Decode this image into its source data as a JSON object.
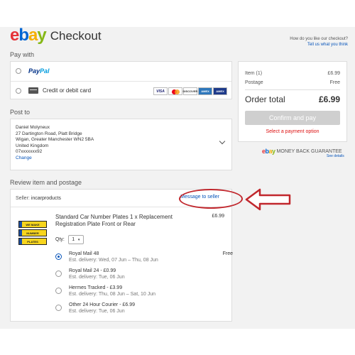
{
  "header": {
    "logo_letters": [
      "e",
      "b",
      "a",
      "y"
    ],
    "title": "Checkout",
    "feedback_question": "How do you like our checkout?",
    "feedback_link": "Tell us what you think"
  },
  "pay_with": {
    "label": "Pay with",
    "options": [
      {
        "name": "PayPal",
        "name_part1": "Pay",
        "name_part2": "Pal"
      },
      {
        "name": "Credit or debit card",
        "card_logos": [
          "VISA",
          "MC",
          "DISCOVER",
          "AMEX",
          "AMEX"
        ]
      }
    ]
  },
  "post_to": {
    "label": "Post to",
    "name": "Daniel Molyneux",
    "line1": "27 Dartington Road, Platt Bridge",
    "line2": "Wigan, Greater Manchester WN2 5BA",
    "country": "United Kingdom",
    "phone": "07xxxxxxx92",
    "change": "Change"
  },
  "review": {
    "label": "Review item and postage",
    "seller_label": "Seller:",
    "seller": "incarproducts",
    "message_seller": "Message to seller",
    "item": {
      "title": "Standard Car Number Plates 1 x Replacement Registration Plate Front or Rear",
      "price": "£6.99",
      "plate_texts": [
        "WE MAKE",
        "NUMBER",
        "PLATES"
      ],
      "qty_label": "Qty:",
      "qty_value": "1"
    },
    "shipping": [
      {
        "name": "Royal Mail 48",
        "est": "Est. delivery: Wed, 07 Jun – Thu, 08 Jun",
        "price": "Free",
        "selected": true
      },
      {
        "name": "Royal Mail 24 - £0.99",
        "est": "Est. delivery: Tue, 06 Jun",
        "price": "",
        "selected": false
      },
      {
        "name": "Hermes Tracked - £3.99",
        "est": "Est. delivery: Thu, 08 Jun – Sat, 10 Jun",
        "price": "",
        "selected": false
      },
      {
        "name": "Other 24 Hour Courier - £6.99",
        "est": "Est. delivery: Tue, 06 Jun",
        "price": "",
        "selected": false
      }
    ]
  },
  "summary": {
    "item_label": "Item (1)",
    "item_value": "£6.99",
    "postage_label": "Postage",
    "postage_value": "Free",
    "total_label": "Order total",
    "total_value": "£6.99",
    "confirm_button": "Confirm and pay",
    "select_payment": "Select a payment option"
  },
  "guarantee": {
    "text": "MONEY BACK GUARANTEE",
    "see_details": "See details"
  },
  "colors": {
    "ebay_e": "#e53238",
    "ebay_b": "#0064d2",
    "ebay_a": "#f5af02",
    "ebay_y": "#86b817",
    "link": "#0654ba",
    "annotation_red": "#c1272d"
  }
}
